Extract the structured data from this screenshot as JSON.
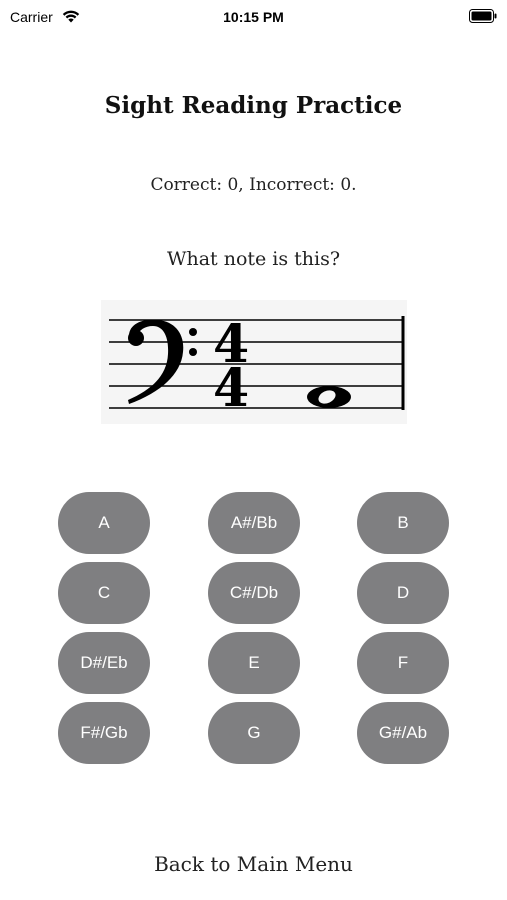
{
  "status_bar": {
    "carrier": "Carrier",
    "time": "10:15 PM",
    "wifi_icon": "wifi-icon",
    "battery_icon": "battery-icon"
  },
  "title": "Sight Reading Practice",
  "score": "Correct: 0, Incorrect: 0.",
  "question": "What note is this?",
  "staff": {
    "clef": "bass",
    "time_signature": "4/4",
    "note": "whole-note"
  },
  "buttons": [
    "A",
    "A#/Bb",
    "B",
    "C",
    "C#/Db",
    "D",
    "D#/Eb",
    "E",
    "F",
    "F#/Gb",
    "G",
    "G#/Ab"
  ],
  "colors": {
    "button_bg": "#7f7f81",
    "button_text": "#ffffff"
  },
  "back_label": "Back to Main Menu"
}
